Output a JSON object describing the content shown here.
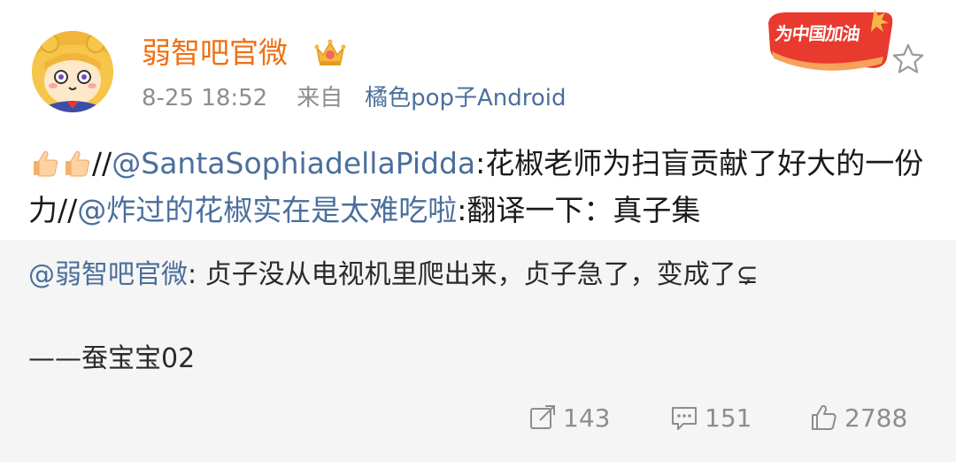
{
  "header": {
    "username": "弱智吧官微",
    "timestamp": "8-25 18:52",
    "source_prefix": "来自",
    "source": "橘色pop子Android",
    "badge_text": "为中国加油",
    "avatar_icon": "pop-team-epic-avatar",
    "crown_icon": "crown-icon",
    "star_icon": "star-icon"
  },
  "post": {
    "emoji": "👍👍",
    "sep1": "//",
    "mention1": "@SantaSophiadellaPidda",
    "text1": ":花椒老师为扫盲贡献了好大的一份力//",
    "mention2": "@炸过的花椒实在是太难吃啦",
    "text2": ":翻译一下：真子集"
  },
  "repost": {
    "mention": "@弱智吧官微",
    "text": ": 贞子没从电视机里爬出来，贞子急了，变成了⊊",
    "signature": "——蚕宝宝02"
  },
  "actions": {
    "repost_count": "143",
    "comment_count": "151",
    "like_count": "2788"
  },
  "colors": {
    "username": "#f06f14",
    "mention": "#4b6f9c",
    "meta": "#8d8d8d",
    "repost_bg": "#f5f5f5",
    "badge": "#e83a2e"
  }
}
